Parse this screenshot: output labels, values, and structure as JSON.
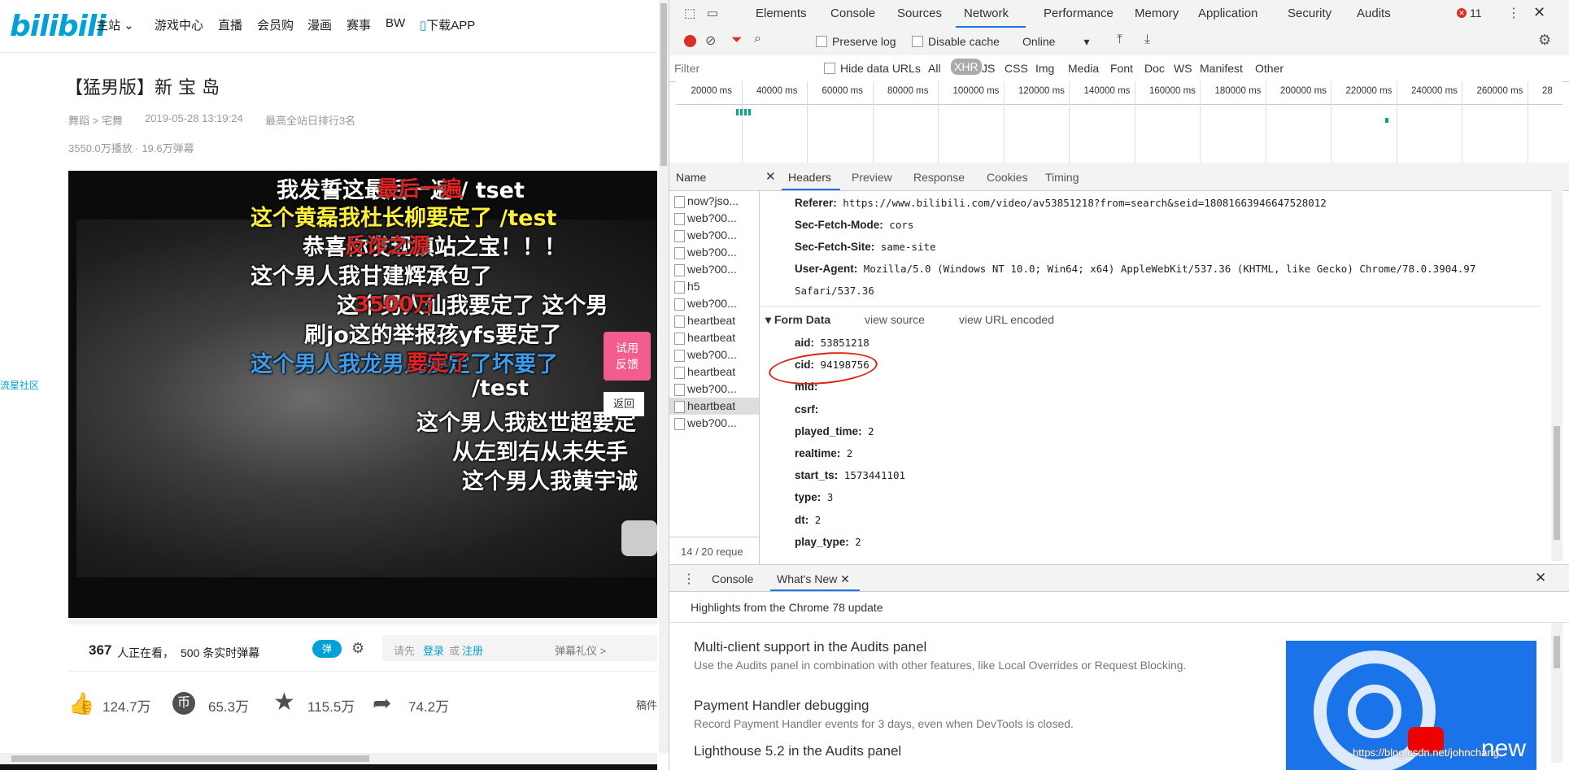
{
  "site": {
    "logo": "bilibili",
    "nav": [
      "主站",
      "游戏中心",
      "直播",
      "会员购",
      "漫画",
      "赛事",
      "BW",
      "下载APP"
    ],
    "side_link": "流星社区"
  },
  "video": {
    "title": "【猛男版】新 宝 岛",
    "category": "舞蹈 > 宅舞",
    "date": "2019-05-28 13:19:24",
    "rank": "最高全站日排行3名",
    "plays": "3550.0万播放 · 19.6万弹幕",
    "danmaku": [
      "我发誓这最后一遍 / tset",
      "这个黄磊我杜长柳要定了 /test",
      "恭喜你发现镇站之宝！！！",
      "这个男人我甘建辉承包了",
      "这个男人仙我要定了 这个男",
      "刷jo这的举报孩yfs要定了",
      "这个男人我龙男凡要定了坏要了",
      "/test",
      "这个男人我赵世超要定",
      "从左到右从未失手",
      "这个男人我黄宇诚"
    ],
    "danmaku_red": [
      "最后一遍",
      "反诈之源",
      "3500万",
      "要定了"
    ],
    "trial_button": "试用\n反馈",
    "back_button": "返回",
    "watching_count": "367",
    "watching_text": "人正在看，",
    "live_danmaku": "500 条实时弹幕",
    "danmaku_toggle": "弹",
    "input_hint": "请先",
    "login": "登录",
    "or": "或",
    "register": "注册",
    "etiquette": "弹幕礼仪 >",
    "likes": "124.7万",
    "coins": "65.3万",
    "favorites": "115.5万",
    "shares": "74.2万",
    "manuscript": "稿件",
    "color_accent": "#00a1d6",
    "color_pink": "#f25d8e"
  },
  "devtools": {
    "tabs": [
      "Elements",
      "Console",
      "Sources",
      "Network",
      "Performance",
      "Memory",
      "Application",
      "Security",
      "Audits"
    ],
    "active_tab": "Network",
    "error_count": "11",
    "preserve_log": "Preserve log",
    "disable_cache": "Disable cache",
    "throttle": "Online",
    "filter_placeholder": "Filter",
    "hide_data_urls": "Hide data URLs",
    "type_filters": [
      "All",
      "XHR",
      "JS",
      "CSS",
      "Img",
      "Media",
      "Font",
      "Doc",
      "WS",
      "Manifest",
      "Other"
    ],
    "active_type": "XHR",
    "timeline_ticks": [
      "20000 ms",
      "40000 ms",
      "60000 ms",
      "80000 ms",
      "100000 ms",
      "120000 ms",
      "140000 ms",
      "160000 ms",
      "180000 ms",
      "200000 ms",
      "220000 ms",
      "240000 ms",
      "260000 ms",
      "28"
    ],
    "name_header": "Name",
    "requests": [
      "now?jso...",
      "web?00...",
      "web?00...",
      "web?00...",
      "web?00...",
      "h5",
      "web?00...",
      "heartbeat",
      "heartbeat",
      "web?00...",
      "heartbeat",
      "web?00...",
      "heartbeat",
      "web?00..."
    ],
    "selected_request_index": 12,
    "request_count": "14 / 20 reque",
    "detail_tabs": [
      "Headers",
      "Preview",
      "Response",
      "Cookies",
      "Timing"
    ],
    "active_detail_tab": "Headers",
    "headers": [
      {
        "key": "Referer:",
        "value": "https://www.bilibili.com/video/av53851218?from=search&seid=18081663946647528012"
      },
      {
        "key": "Sec-Fetch-Mode:",
        "value": "cors"
      },
      {
        "key": "Sec-Fetch-Site:",
        "value": "same-site"
      },
      {
        "key": "User-Agent:",
        "value": "Mozilla/5.0 (Windows NT 10.0; Win64; x64) AppleWebKit/537.36 (KHTML, like Gecko) Chrome/78.0.3904.97"
      },
      {
        "key": "",
        "value": "Safari/537.36"
      }
    ],
    "form_data_title": "Form Data",
    "view_source": "view source",
    "view_url_encoded": "view URL encoded",
    "form_data": [
      {
        "key": "aid:",
        "value": "53851218"
      },
      {
        "key": "cid:",
        "value": "94198756"
      },
      {
        "key": "mid:",
        "value": ""
      },
      {
        "key": "csrf:",
        "value": ""
      },
      {
        "key": "played_time:",
        "value": "2"
      },
      {
        "key": "realtime:",
        "value": "2"
      },
      {
        "key": "start_ts:",
        "value": "1573441101"
      },
      {
        "key": "type:",
        "value": "3"
      },
      {
        "key": "dt:",
        "value": "2"
      },
      {
        "key": "play_type:",
        "value": "2"
      }
    ],
    "drawer_tabs": [
      "Console",
      "What's New"
    ],
    "active_drawer_tab": "What's New",
    "highlights": "Highlights from the Chrome 78 update",
    "news": [
      {
        "title": "Multi-client support in the Audits panel",
        "desc": "Use the Audits panel in combination with other features, like Local Overrides or Request Blocking."
      },
      {
        "title": "Payment Handler debugging",
        "desc": "Record Payment Handler events for 3 days, even when DevTools is closed."
      },
      {
        "title": "Lighthouse 5.2 in the Audits panel",
        "desc": ""
      }
    ],
    "new_badge": "new",
    "watermark": "https://blog.csdn.net/johnchang"
  }
}
